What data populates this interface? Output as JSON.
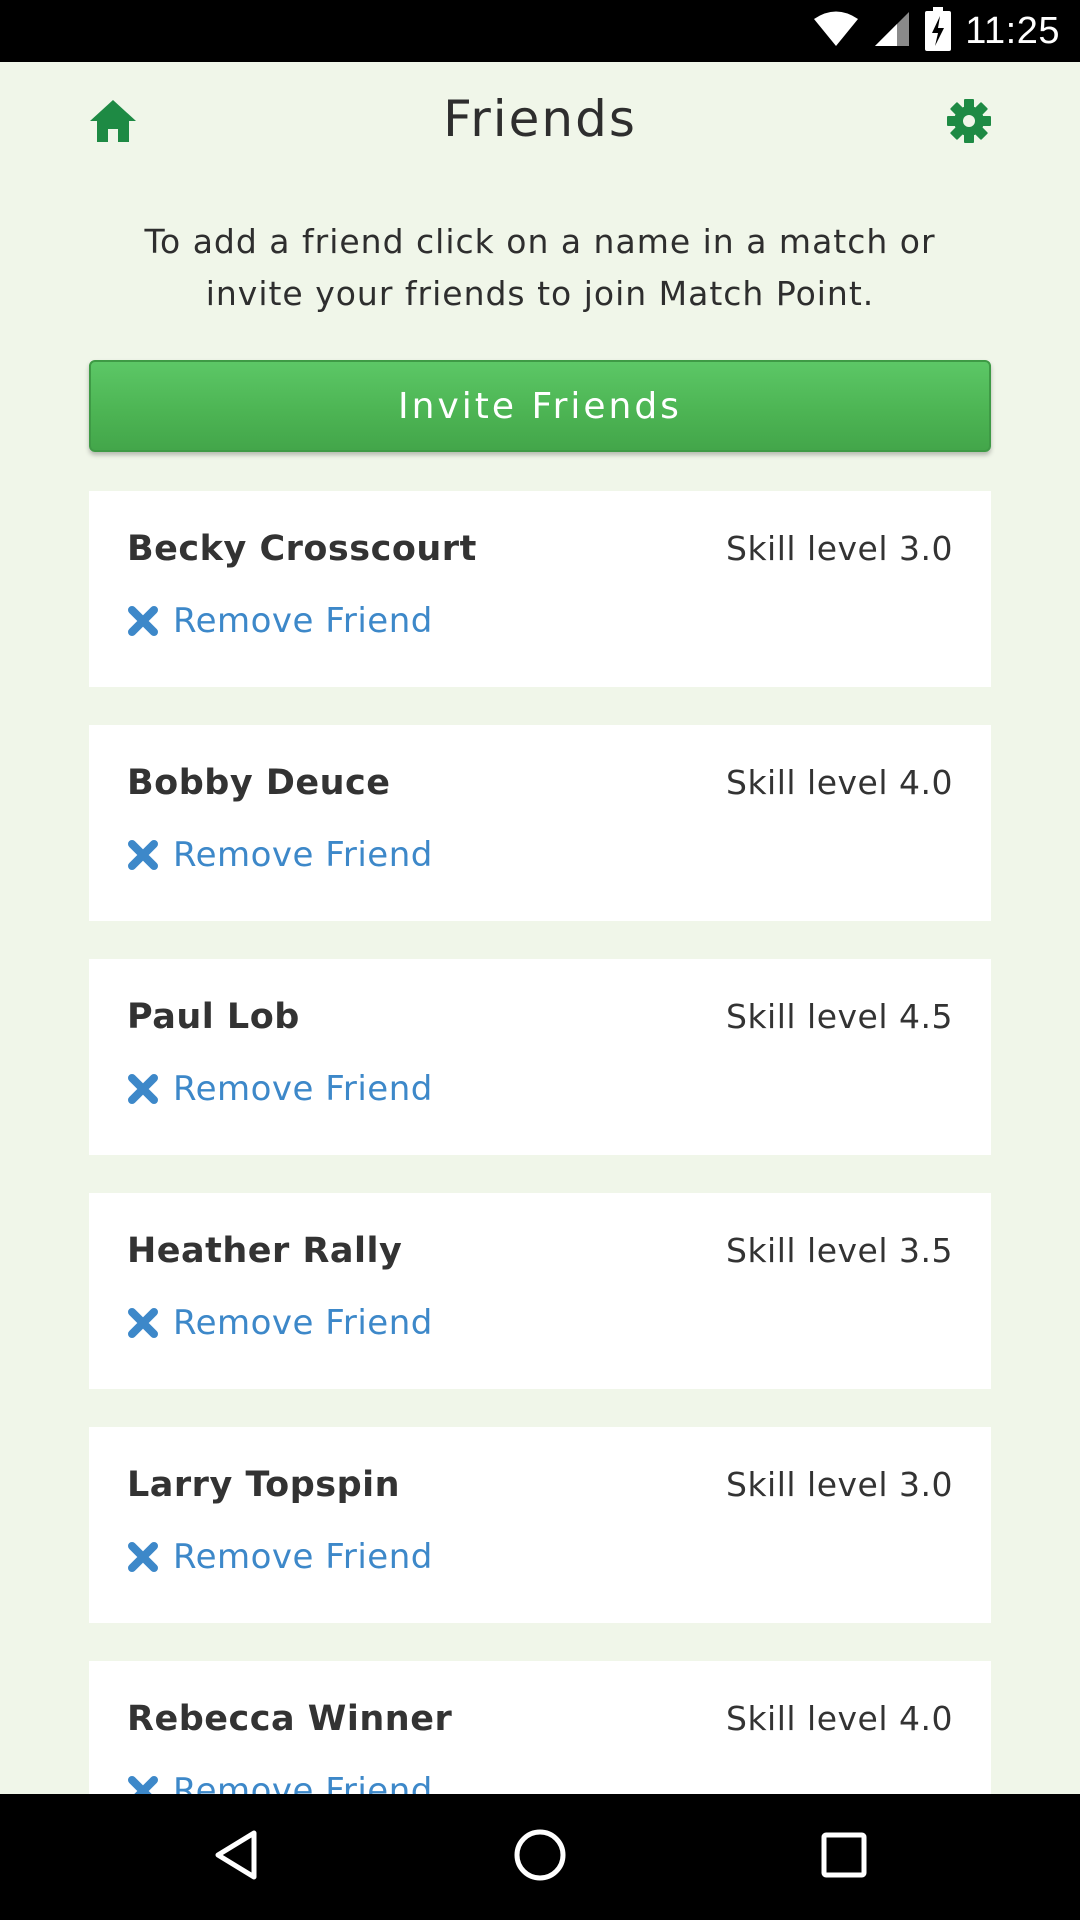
{
  "status_bar": {
    "time": "11:25",
    "icons": [
      "wifi-icon",
      "signal-icon",
      "battery-charging-icon"
    ]
  },
  "header": {
    "title": "Friends",
    "left_icon": "home-icon",
    "right_icon": "gear-icon"
  },
  "instructions": "To add a friend click on a name in a match or invite your friends to join Match Point.",
  "invite_button": {
    "label": "Invite Friends"
  },
  "remove_label": "Remove Friend",
  "friends": [
    {
      "name": "Becky Crosscourt",
      "skill": "Skill level 3.0",
      "remove": "Remove Friend"
    },
    {
      "name": "Bobby Deuce",
      "skill": "Skill level 4.0",
      "remove": "Remove Friend"
    },
    {
      "name": "Paul Lob",
      "skill": "Skill level 4.5",
      "remove": "Remove Friend"
    },
    {
      "name": "Heather Rally",
      "skill": "Skill level 3.5",
      "remove": "Remove Friend"
    },
    {
      "name": "Larry Topspin",
      "skill": "Skill level 3.0",
      "remove": "Remove Friend"
    },
    {
      "name": "Rebecca Winner",
      "skill": "Skill level 4.0",
      "remove": "Remove Friend"
    }
  ],
  "nav_bar": {
    "buttons": [
      "back-icon",
      "home-circle-icon",
      "recents-icon"
    ]
  },
  "colors": {
    "background": "#f0f6e9",
    "brand_green": "#1e8a44",
    "button_green": "#4db554",
    "link_blue": "#3d88c9"
  }
}
